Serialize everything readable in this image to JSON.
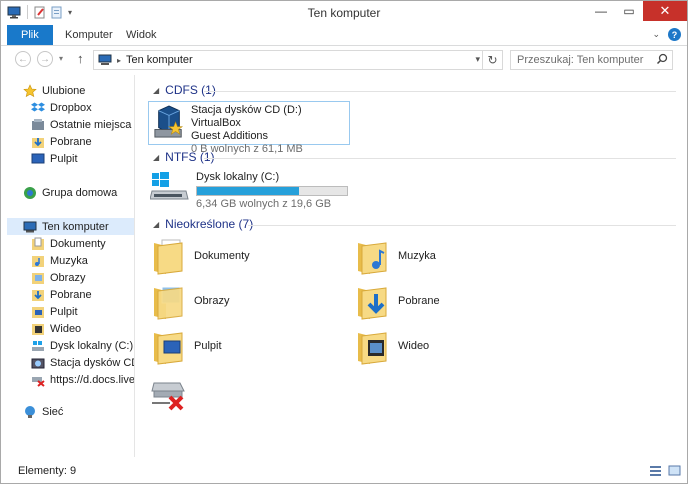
{
  "window": {
    "title": "Ten komputer"
  },
  "ribbon": {
    "tabs": [
      {
        "label": "Plik"
      },
      {
        "label": "Komputer"
      },
      {
        "label": "Widok"
      }
    ]
  },
  "address": {
    "path": "Ten komputer",
    "search_placeholder": "Przeszukaj: Ten komputer"
  },
  "nav": {
    "favorites_label": "Ulubione",
    "favorites": [
      "Dropbox",
      "Ostatnie miejsca",
      "Pobrane",
      "Pulpit"
    ],
    "homegroup": "Grupa domowa",
    "computer": "Ten komputer",
    "computer_items": [
      "Dokumenty",
      "Muzyka",
      "Obrazy",
      "Pobrane",
      "Pulpit",
      "Wideo",
      "Dysk lokalny (C:)",
      "Stacja dysków CD (D",
      "https://d.docs.live.n"
    ],
    "network": "Sieć"
  },
  "groups": {
    "cdfs": {
      "label": "CDFS (1)",
      "item_title": "Stacja dysków CD (D:) VirtualBox",
      "item_title2": "Guest Additions",
      "item_free": "0 B wolnych z 61,1 MB"
    },
    "ntfs": {
      "label": "NTFS (1)",
      "item_title": "Dysk lokalny (C:)",
      "item_free": "6,34 GB wolnych z 19,6 GB",
      "usage_fraction": 0.68
    },
    "other": {
      "label": "Nieokreślone (7)",
      "folders": [
        "Dokumenty",
        "Muzyka",
        "Obrazy",
        "Pobrane",
        "Pulpit",
        "Wideo"
      ]
    }
  },
  "status": {
    "items": "Elementy: 9"
  },
  "colors": {
    "accent": "#1979ca",
    "group_header": "#1e3287",
    "drive_bar": "#26a0da",
    "close": "#c7312a"
  }
}
